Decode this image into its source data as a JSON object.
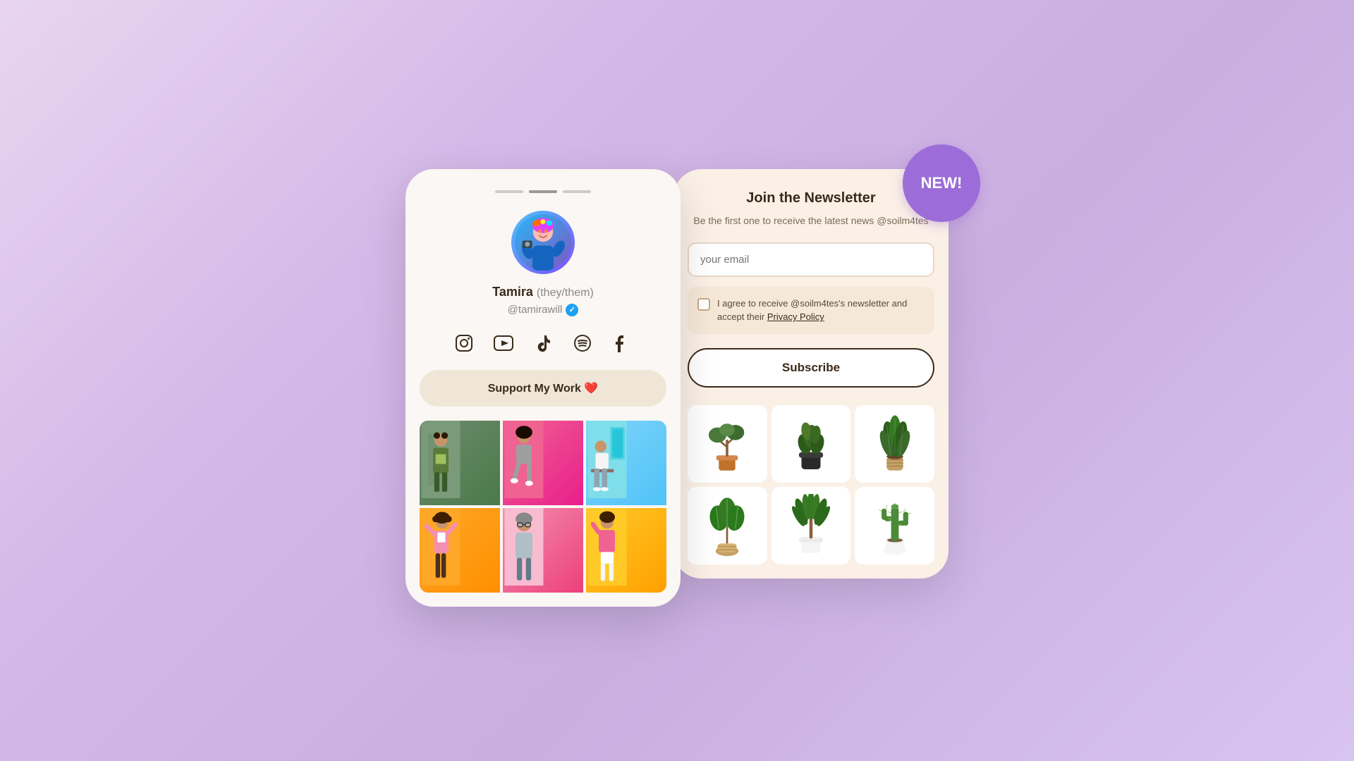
{
  "left_phone": {
    "notch_bars": [
      "bar1",
      "bar2",
      "bar3"
    ],
    "profile": {
      "name": "Tamira",
      "pronoun": "(they/them)",
      "handle": "@tamirawill",
      "verified": true
    },
    "social_icons": [
      {
        "name": "instagram-icon",
        "symbol": "📷"
      },
      {
        "name": "youtube-icon",
        "symbol": "▶"
      },
      {
        "name": "tiktok-icon",
        "symbol": "♪"
      },
      {
        "name": "spotify-icon",
        "symbol": "♫"
      },
      {
        "name": "facebook-icon",
        "symbol": "f"
      }
    ],
    "support_button": {
      "label": "Support My Work",
      "emoji": "❤️"
    },
    "photos": [
      {
        "id": "photo-1",
        "style": "olive-green"
      },
      {
        "id": "photo-2",
        "style": "pink"
      },
      {
        "id": "photo-3",
        "style": "blue-teal"
      },
      {
        "id": "photo-4",
        "style": "orange"
      },
      {
        "id": "photo-5",
        "style": "pink-silver"
      },
      {
        "id": "photo-6",
        "style": "yellow-orange"
      }
    ]
  },
  "right_panel": {
    "new_badge": "NEW!",
    "newsletter": {
      "title": "Join the Newsletter",
      "description": "Be the first one to receive the latest news @soilm4tes",
      "email_placeholder": "your email",
      "checkbox_text": "I agree to receive @soilm4tes's newsletter and accept their",
      "privacy_policy_label": "Privacy Policy",
      "subscribe_button": "Subscribe"
    },
    "plants": [
      {
        "id": "plant-1",
        "type": "bonsai"
      },
      {
        "id": "plant-2",
        "type": "rubber-plant"
      },
      {
        "id": "plant-3",
        "type": "tall-leaves"
      },
      {
        "id": "plant-4",
        "type": "fiddle-leaf"
      },
      {
        "id": "plant-5",
        "type": "dracaena"
      },
      {
        "id": "plant-6",
        "type": "cactus"
      }
    ]
  }
}
